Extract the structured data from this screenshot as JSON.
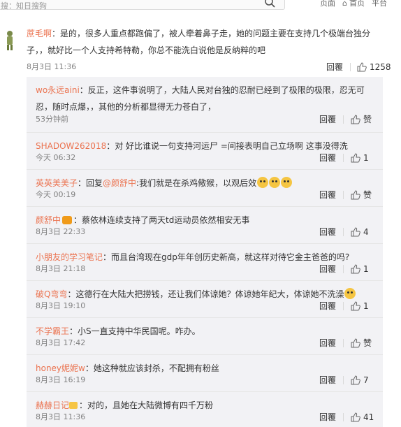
{
  "search": {
    "placeholder": "搜：知日搜狗"
  },
  "topbar": {
    "item_a": "页面",
    "item_b": "首页",
    "item_c": "平台"
  },
  "main_comment": {
    "user": "蔗毛啊",
    "text": "：是的，很多人重点都跑偏了，被人牵着鼻子走，她的问题主要在支持几个极端台独分子，，就好比一个人支持希特勒，你总不能洗白说他是反纳粹的吧",
    "time": "8月3日 11:36",
    "reply_label": "回覆",
    "like_count": "1258"
  },
  "replies": [
    {
      "user": "wo永远aini",
      "text": "：反正，这件事说明了，大陆人民对台独的忍耐已经到了极限的极限，忍无可忍，随时点爆，，其他的分析都显得无力苍白了，",
      "time": "53分钟前",
      "reply_label": "回覆",
      "like_label": "赞"
    },
    {
      "user": "SHADOW262018",
      "text": "：对 好比谁说一句支持河运尸 =间接表明自己立场啊 这事没得洗",
      "time": "今天 06:32",
      "reply_label": "回覆",
      "like_label": "1"
    },
    {
      "user": "英英美美子",
      "text_pre": "：回复",
      "mention": "@颜舒中",
      "text": ":我们就是在杀鸡儆猴，以观后效",
      "time": "今天 00:19",
      "reply_label": "回覆",
      "like_label": "赞"
    },
    {
      "user": "颜舒中",
      "text": "：蔡依林连续支持了两天td运动员依然相安无事",
      "time": "8月3日 22:33",
      "reply_label": "回覆",
      "like_label": "4"
    },
    {
      "user": "小朋友的学习笔记",
      "text": "：而且台湾现在gdp年年创历史新高，就这样对待它金主爸爸的吗?",
      "time": "8月3日 21:18",
      "reply_label": "回覆",
      "like_label": "1"
    },
    {
      "user": "破Q弯弯",
      "text": "：这德行在大陆大把捞钱，还让我们体谅她？体谅她年纪大，体谅她不洗澡",
      "time": "8月3日 19:10",
      "reply_label": "回覆",
      "like_label": "1"
    },
    {
      "user": "不学霸王",
      "text": "：小S一直支持中华民国呢。咋办。",
      "time": "8月3日 17:42",
      "reply_label": "回覆",
      "like_label": "赞"
    },
    {
      "user": "honey妮妮w",
      "text": "：她这种就应该封杀，不配拥有粉丝",
      "time": "8月3日 16:19",
      "reply_label": "回覆",
      "like_label": "7"
    },
    {
      "user": "赫赫日记",
      "text": "：对的，且她在大陆微博有四千万粉",
      "time": "8月3日 11:36",
      "reply_label": "回覆",
      "like_label": "41"
    }
  ],
  "colors": {
    "username": "#eb7350",
    "mention": "#eb7350",
    "panel_bg": "#f2f2f5"
  },
  "icons": [
    "search-icon",
    "thumbs-up-icon",
    "emoji-icon",
    "vip-badge-icon"
  ]
}
